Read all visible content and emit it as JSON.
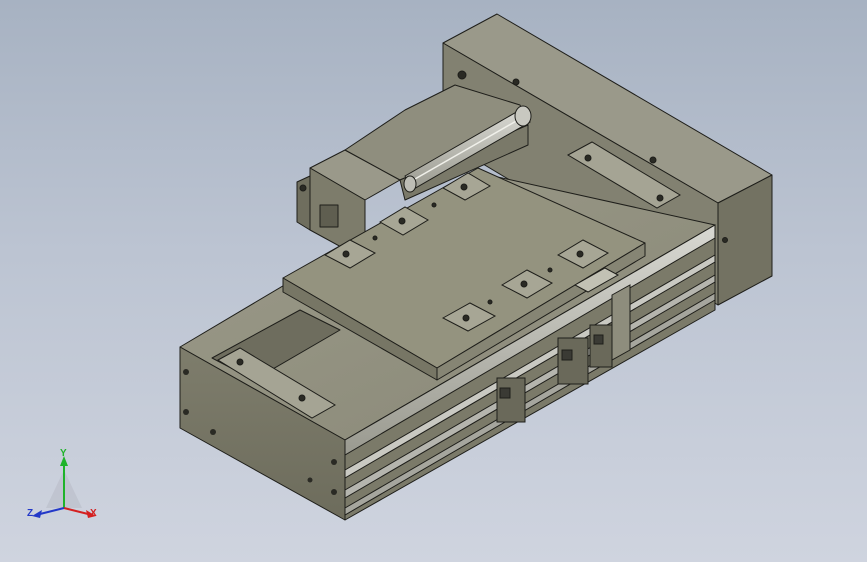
{
  "viewport": {
    "background_top": "#a7b2c2",
    "background_bottom": "#cfd4df",
    "part_color": "#8c8b7a",
    "edge_color": "#1e1e1a"
  },
  "triad": {
    "x_label": "X",
    "y_label": "Y",
    "z_label": "Z",
    "x_color": "#d42020",
    "y_color": "#1fb32a",
    "z_color": "#2238c8"
  }
}
